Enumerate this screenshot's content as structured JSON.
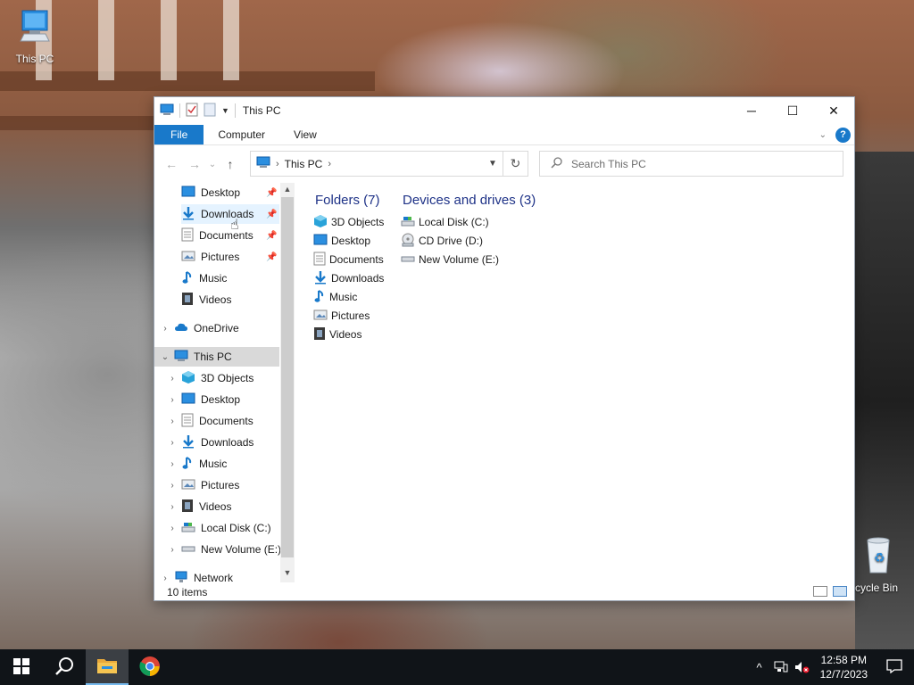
{
  "desktop": {
    "icons": [
      {
        "label": "This PC",
        "icon": "this-pc-icon"
      },
      {
        "label": "cycle Bin",
        "icon": "recycle-bin-icon"
      }
    ]
  },
  "window": {
    "title": "This PC",
    "controls": {
      "minimize": "─",
      "maximize": "☐",
      "close": "✕"
    }
  },
  "ribbon": {
    "tabs": [
      {
        "label": "File",
        "active": true
      },
      {
        "label": "Computer"
      },
      {
        "label": "View"
      }
    ],
    "help": "?"
  },
  "nav": {
    "back": "←",
    "forward": "→",
    "recent": "⌄",
    "up": "↑",
    "address": {
      "segments": [
        "This PC"
      ],
      "separator": "›"
    },
    "refresh": "↻",
    "search_placeholder": "Search This PC"
  },
  "navpane": {
    "quick_access": [
      {
        "label": "Desktop",
        "icon": "desktop-icon",
        "pinned": true
      },
      {
        "label": "Downloads",
        "icon": "downloads-icon",
        "pinned": true
      },
      {
        "label": "Documents",
        "icon": "documents-icon",
        "pinned": true
      },
      {
        "label": "Pictures",
        "icon": "pictures-icon",
        "pinned": true
      },
      {
        "label": "Music",
        "icon": "music-icon",
        "pinned": false
      },
      {
        "label": "Videos",
        "icon": "videos-icon",
        "pinned": false
      }
    ],
    "onedrive": {
      "label": "OneDrive",
      "icon": "onedrive-icon"
    },
    "this_pc": {
      "label": "This PC",
      "icon": "this-pc-icon"
    },
    "this_pc_children": [
      {
        "label": "3D Objects",
        "icon": "3d-objects-icon"
      },
      {
        "label": "Desktop",
        "icon": "desktop-icon"
      },
      {
        "label": "Documents",
        "icon": "documents-icon"
      },
      {
        "label": "Downloads",
        "icon": "downloads-icon"
      },
      {
        "label": "Music",
        "icon": "music-icon"
      },
      {
        "label": "Pictures",
        "icon": "pictures-icon"
      },
      {
        "label": "Videos",
        "icon": "videos-icon"
      },
      {
        "label": "Local Disk (C:)",
        "icon": "local-disk-icon"
      },
      {
        "label": "New Volume (E:)",
        "icon": "drive-icon"
      }
    ],
    "network": {
      "label": "Network",
      "icon": "network-icon"
    }
  },
  "content": {
    "folders_title": "Folders (7)",
    "folders": [
      {
        "label": "3D Objects",
        "icon": "3d-objects-icon"
      },
      {
        "label": "Desktop",
        "icon": "desktop-icon"
      },
      {
        "label": "Documents",
        "icon": "documents-icon"
      },
      {
        "label": "Downloads",
        "icon": "downloads-icon"
      },
      {
        "label": "Music",
        "icon": "music-icon"
      },
      {
        "label": "Pictures",
        "icon": "pictures-icon"
      },
      {
        "label": "Videos",
        "icon": "videos-icon"
      }
    ],
    "drives_title": "Devices and drives (3)",
    "drives": [
      {
        "label": "Local Disk (C:)",
        "icon": "local-disk-icon"
      },
      {
        "label": "CD Drive (D:)",
        "icon": "cd-drive-icon"
      },
      {
        "label": "New Volume (E:)",
        "icon": "drive-icon"
      }
    ]
  },
  "status": {
    "items": "10 items"
  },
  "taskbar": {
    "apps": [
      {
        "name": "start",
        "icon": "windows-logo-icon"
      },
      {
        "name": "search",
        "icon": "search-icon"
      },
      {
        "name": "file-explorer",
        "icon": "file-explorer-icon",
        "active": true
      },
      {
        "name": "chrome",
        "icon": "chrome-icon"
      }
    ],
    "time": "12:58 PM",
    "date": "12/7/2023"
  },
  "colors": {
    "accent": "#1979ca",
    "group_title": "#1e3287",
    "taskbar": "#101418",
    "selected": "#d9d9d9"
  }
}
